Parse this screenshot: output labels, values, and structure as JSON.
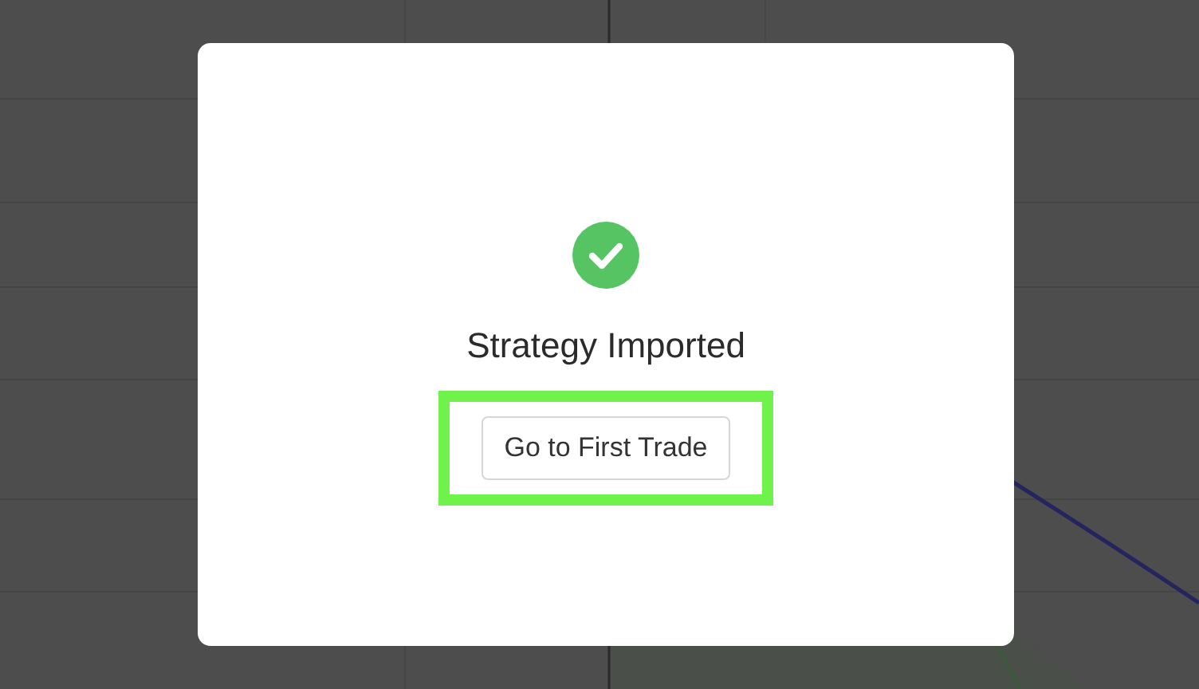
{
  "dialog": {
    "success": true,
    "title": "Strategy Imported",
    "button": {
      "label": "Go to First Trade",
      "highlighted": true
    }
  }
}
